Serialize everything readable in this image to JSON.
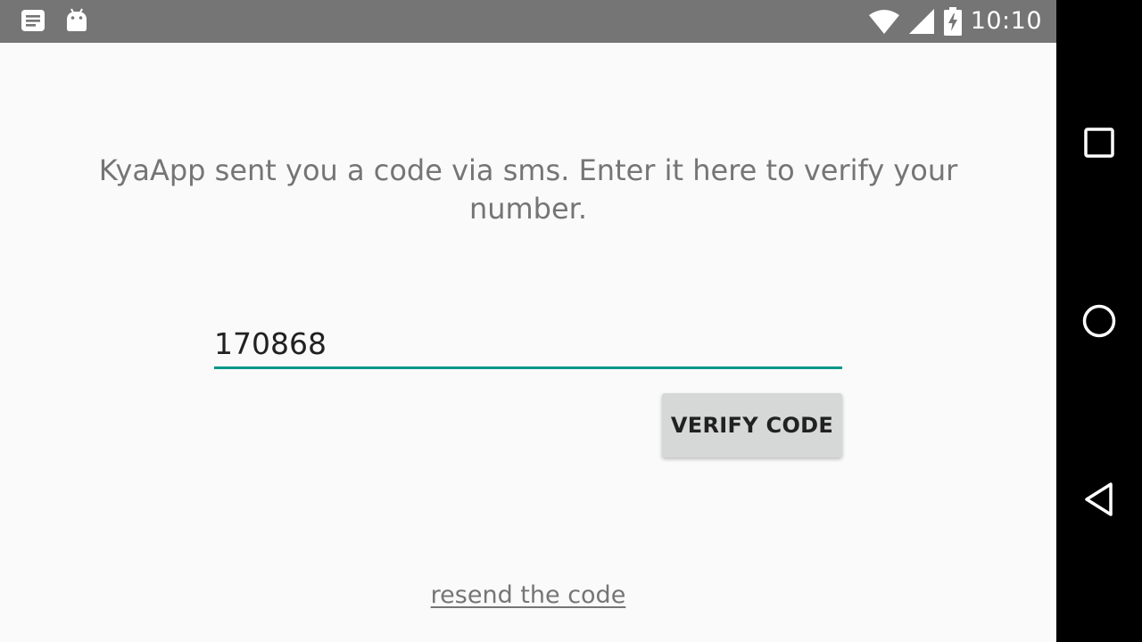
{
  "status_bar": {
    "time": "10:10",
    "icons": [
      "notification-list-icon",
      "android-icon",
      "wifi-icon",
      "cellular-signal-icon",
      "battery-charging-icon"
    ]
  },
  "verification": {
    "message": "KyaApp sent you a code via sms. Enter it here to verify your number.",
    "code_value": "170868",
    "verify_button_label": "VERIFY CODE",
    "resend_link_label": "resend the code"
  },
  "colors": {
    "status_bar": "#757575",
    "nav_bar": "#000000",
    "background": "#fafafa",
    "accent": "#009688",
    "button": "#d6d7d7",
    "text_secondary": "#757575",
    "text_primary": "#212121"
  },
  "nav_bar": {
    "buttons": [
      "recents-icon",
      "home-icon",
      "back-icon"
    ]
  }
}
